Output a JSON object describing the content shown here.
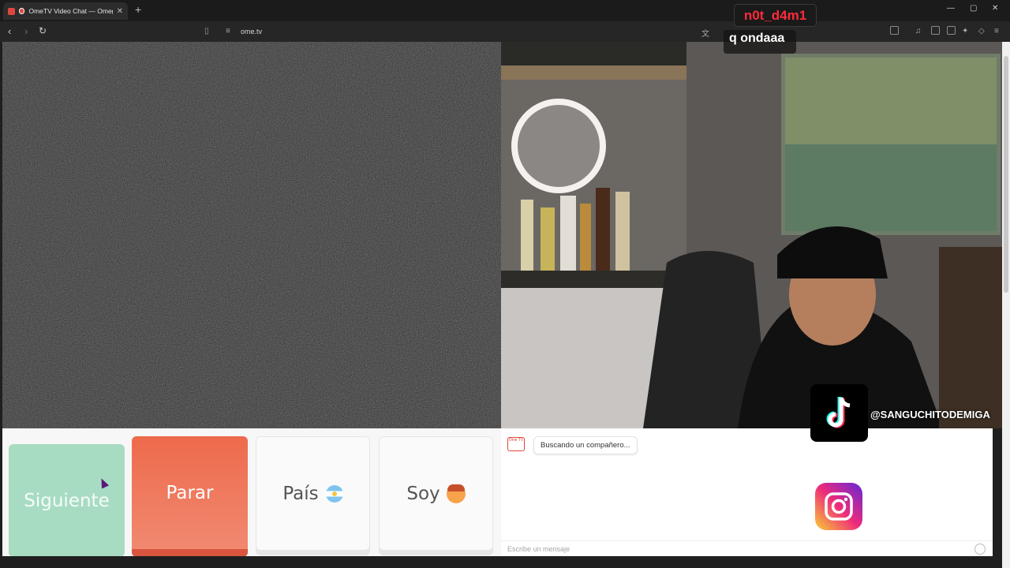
{
  "browser": {
    "tab_title": "OmeTV Video Chat — Omegle",
    "new_tab": "+",
    "close_tab": "✕",
    "url": "ome.tv",
    "window_controls": {
      "minimize": "—",
      "maximize": "▢",
      "close": "✕"
    }
  },
  "overlay": {
    "username": "n0t_d4m1",
    "chat_message": "q ondaaa",
    "tiktok_handle": "@SANGUCHITODEMIGA"
  },
  "controls": {
    "next_label": "Siguiente",
    "stop_label": "Parar",
    "country_label": "País",
    "gender_label": "Soy"
  },
  "chat": {
    "logo_text": "Ome TV",
    "status_message": "Buscando un compañero...",
    "input_placeholder": "Escribe un mensaje"
  },
  "icons": {
    "back": "back-arrow-icon",
    "forward": "forward-arrow-icon",
    "reload": "reload-icon",
    "bookmark": "bookmark-icon",
    "country_flag": "argentina-flag-icon",
    "gender_avatar": "boy-face-icon",
    "emoji": "emoji-icon"
  },
  "colors": {
    "next": "#a7dcc3",
    "stop": "#ee6a4c",
    "username": "#ff2b3b"
  }
}
